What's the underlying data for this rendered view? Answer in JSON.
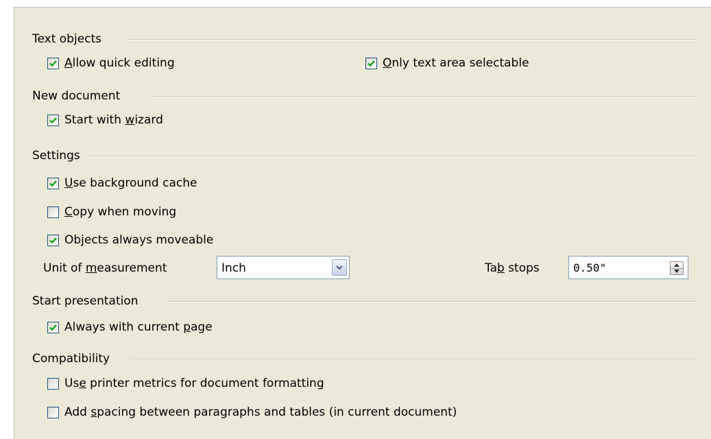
{
  "sections": {
    "text_objects": {
      "title": "Text objects",
      "allow_quick_editing": {
        "pre": "",
        "key": "A",
        "post": "llow quick editing",
        "checked": true
      },
      "only_text_area_selectable": {
        "pre": "",
        "key": "O",
        "post": "nly text area selectable",
        "checked": true
      }
    },
    "new_document": {
      "title": "New document",
      "start_with_wizard": {
        "pre": "Start with ",
        "key": "w",
        "post": "izard",
        "checked": true
      }
    },
    "settings": {
      "title": "Settings",
      "use_background_cache": {
        "pre": "",
        "key": "U",
        "post": "se background cache",
        "checked": true
      },
      "copy_when_moving": {
        "pre": "",
        "key": "C",
        "post": "opy when moving",
        "checked": false
      },
      "objects_always_moveable": {
        "pre": "Ob",
        "key": "j",
        "post": "ects always moveable",
        "checked": true
      },
      "unit_of_measurement": {
        "pre": "Unit of ",
        "key": "m",
        "post": "easurement",
        "value": "Inch"
      },
      "tab_stops": {
        "pre": "Ta",
        "key": "b",
        "post": " stops",
        "value": "0.50\""
      }
    },
    "start_presentation": {
      "title": "Start presentation",
      "always_with_current_page": {
        "pre": "Always with current ",
        "key": "p",
        "post": "age",
        "checked": true
      }
    },
    "compatibility": {
      "title": "Compatibility",
      "use_printer_metrics": {
        "pre": "Us",
        "key": "e",
        "post": " printer metrics for document formatting",
        "checked": false
      },
      "add_spacing": {
        "pre": "Add ",
        "key": "s",
        "post": "pacing between paragraphs and tables (in current document)",
        "checked": false
      }
    }
  },
  "icons": {
    "checkmark": "checkmark-icon",
    "dropdown": "chevron-down-icon",
    "spin_up": "spin-up-icon",
    "spin_down": "spin-down-icon"
  },
  "colors": {
    "panel_background": "#ece9d8",
    "checkmark": "#21a121",
    "checkbox_border": "#1c5180",
    "field_border": "#7f9db9"
  }
}
